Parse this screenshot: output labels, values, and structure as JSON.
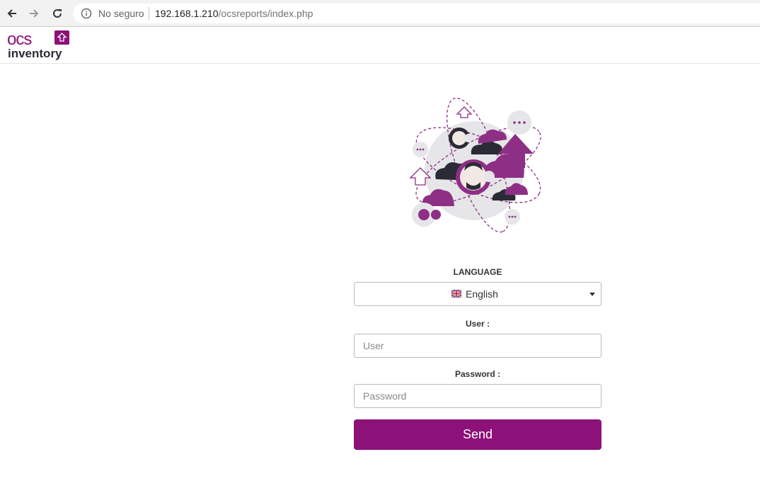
{
  "browser": {
    "security_label": "No seguro",
    "url_host": "192.168.1.210",
    "url_path": "/ocsreports/index.php"
  },
  "logo": {
    "line1": "ocs",
    "line2": "inventory"
  },
  "colors": {
    "brand": "#8c1178",
    "dark": "#2b2b36",
    "cloud": "#8e2f86"
  },
  "login": {
    "language_label": "LANGUAGE",
    "language_value": "English",
    "user_label": "User :",
    "user_placeholder": "User",
    "password_label": "Password :",
    "password_placeholder": "Password",
    "send_label": "Send"
  }
}
